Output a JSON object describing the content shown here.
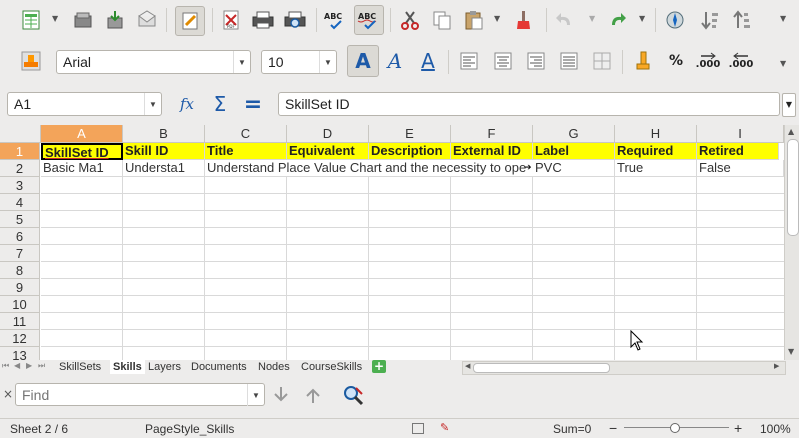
{
  "toolbar1": {
    "icons": [
      "new-spreadsheet-icon",
      "templates-icon",
      "open-icon",
      "save-icon",
      "email-icon",
      "edit-mode-icon",
      "export-pdf-icon",
      "print-icon",
      "print-preview-icon",
      "spellcheck-icon",
      "autospellcheck-icon",
      "cut-icon",
      "copy-icon",
      "paste-icon",
      "clone-formatting-icon",
      "undo-icon",
      "redo-icon",
      "navigator-icon",
      "sort-descending-icon",
      "sort-ascending-icon"
    ]
  },
  "toolbar2": {
    "font_name": "Arial",
    "font_size": "10",
    "format_labels": {
      "percent": "%",
      "decimal_add": ".000",
      "decimal_del": ".000"
    }
  },
  "formula_bar": {
    "name_box": "A1",
    "content": "SkillSet ID"
  },
  "columns": [
    "A",
    "B",
    "C",
    "D",
    "E",
    "F",
    "G",
    "H",
    "I"
  ],
  "rows": [
    "1",
    "2",
    "3",
    "4",
    "5",
    "6",
    "7",
    "8",
    "9",
    "10",
    "11",
    "12",
    "13"
  ],
  "header_row": [
    "SkillSet ID",
    "Skill ID",
    "Title",
    "Equivalent",
    "Description",
    "External ID",
    "Label",
    "Required",
    "Retired"
  ],
  "data_row": {
    "a": "Basic Ma1",
    "b": "Understa1",
    "c": "Understand Place Value Chart and the necessity to ope",
    "g": "PVC",
    "h": "True",
    "i": "False"
  },
  "sheet_tabs": [
    "SkillSets",
    "Skills",
    "Layers",
    "Documents",
    "Nodes",
    "CourseSkills"
  ],
  "active_tab": "Skills",
  "find": {
    "placeholder": "Find"
  },
  "status": {
    "sheet": "Sheet 2 / 6",
    "page_style": "PageStyle_Skills",
    "sum": "Sum=0",
    "zoom": "100%"
  },
  "colors": {
    "header_fill": "#ffff00",
    "selection": "#f3a45a",
    "toolbar_bg": "#edeceb"
  }
}
